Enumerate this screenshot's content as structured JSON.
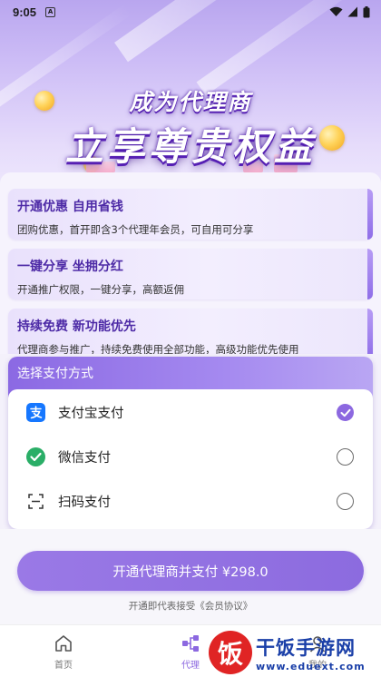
{
  "status_bar": {
    "time": "9:05",
    "notification_icon": "a-square-icon",
    "icons": [
      "wifi-icon",
      "signal-icon",
      "battery-icon"
    ]
  },
  "hero": {
    "title": "成为代理商",
    "headline": "立享尊贵权益"
  },
  "benefits": [
    {
      "title": "开通优惠 自用省钱",
      "desc": "团购优惠，首开即含3个代理年会员，可自用可分享"
    },
    {
      "title": "一键分享 坐拥分红",
      "desc": "开通推广权限，一键分享，高额返佣"
    },
    {
      "title": "持续免费 新功能优先",
      "desc": "代理商参与推广，持续免费使用全部功能，高级功能优先使用"
    }
  ],
  "payment": {
    "header": "选择支付方式",
    "options": [
      {
        "label": "支付宝支付",
        "icon": "alipay-icon",
        "selected": true
      },
      {
        "label": "微信支付",
        "icon": "wechat-icon",
        "selected": false
      },
      {
        "label": "扫码支付",
        "icon": "scan-icon",
        "selected": false
      }
    ]
  },
  "action": {
    "button_label": "开通代理商并支付 ¥298.0",
    "agreement": "开通即代表接受《会员协议》"
  },
  "nav": [
    {
      "label": "首页",
      "icon": "home-icon",
      "active": false
    },
    {
      "label": "代理",
      "icon": "agent-icon",
      "active": true
    },
    {
      "label": "我的",
      "icon": "user-icon",
      "active": false
    }
  ],
  "watermark": {
    "name": "干饭手游网",
    "url": "www.eduext.com",
    "logo_char": "饭"
  },
  "colors": {
    "accent": "#8c68e0",
    "title_purple": "#4d2aa6",
    "alipay": "#1677ff",
    "wechat": "#2aae67"
  }
}
